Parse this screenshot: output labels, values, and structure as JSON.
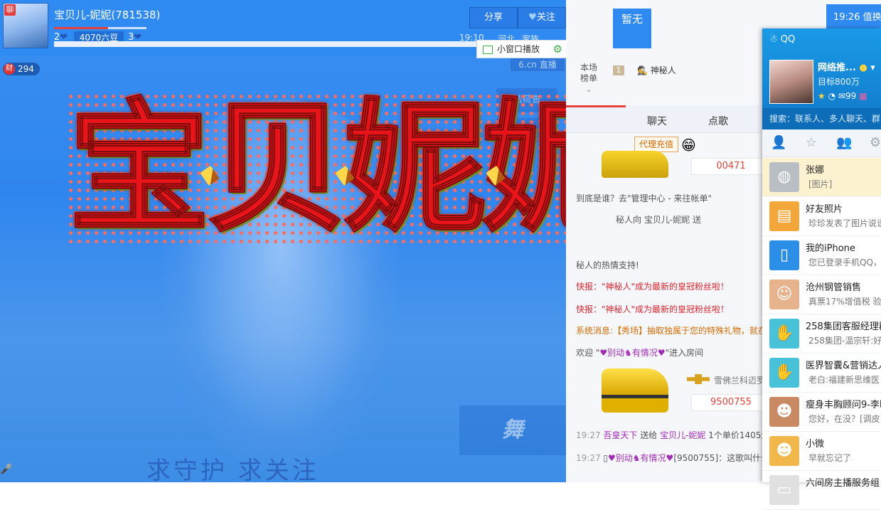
{
  "room": {
    "anchor_name": "宝贝儿-妮妮(781538)",
    "level_left": "2",
    "beans": "4070六豆",
    "level_right": "3",
    "share_label": "分享",
    "follow_label": "关注",
    "time": "19:10",
    "location": "河北",
    "location2": "家族",
    "mini_play": "小窗口播放",
    "wealth_icon": "财",
    "wealth_value": "294",
    "site_tag": "6.cn",
    "site_tag2": "直播",
    "ghost_btn1": "结荷鲁",
    "ghost_btn2": "直",
    "big_text": "宝贝妮妮",
    "slogan": "求守护   求关注",
    "show_logo": "舞",
    "chat_badge": "聊"
  },
  "right": {
    "none_label": "暂无",
    "clock": "19:26",
    "clock_suffix": "值换",
    "rank_label_1": "本场",
    "rank_label_2": "榜单",
    "rank_num": "1",
    "rank_name": "神秘人",
    "tabs": [
      "聊天",
      "点歌"
    ],
    "agent": "代理充值",
    "car_number_1": "00471",
    "msg_who": "到底是谁？去\"管理中心 - 来往帐单\"",
    "msg_send": "秘人向 宝贝儿-妮妮 送",
    "msg_support": "秘人的热情支持!",
    "news1": "快报：\"神秘人\"成为最新的皇冠粉丝啦！",
    "news2": "快报：\"神秘人\"成为最新的皇冠粉丝啦！",
    "system": "系统消息:【秀场】抽取独属于您的特殊礼物，就在",
    "welcome_prefix": "欢迎 \"",
    "welcome_name": "♥别动♞有情况♥",
    "welcome_suffix": "\"进入房间",
    "car_brand": "雪佛兰科迈罗",
    "car_number_2": "9500755",
    "line1_time": "19:27",
    "line1_user": "吾皇天下",
    "line1_mid": " 送给 ",
    "line1_anchor": "宝贝儿-妮妮",
    "line1_tail": " 1个单价1405六",
    "line2_time": "19:27",
    "line2_user": "♥别动♞有情况♥",
    "line2_tail": "[9500755]：这歌叫什么"
  },
  "qq": {
    "title": "QQ",
    "nick": "网络推...",
    "sign": "目标800万",
    "mail_count": "99",
    "search": "搜索：联系人、多人聊天、群",
    "contacts": [
      {
        "name": "张娜",
        "msg": "[图片]",
        "color": "#b9bec4",
        "icon": "◍"
      },
      {
        "name": "好友照片",
        "msg": "珍珍发表了图片说说",
        "color": "#f3a73a",
        "icon": "▤"
      },
      {
        "name": "我的iPhone",
        "msg": "您已登录手机QQ，可",
        "color": "#2b8fe8",
        "icon": "▯"
      },
      {
        "name": "沧州钢管销售",
        "msg": "真票17%增值税 验",
        "color": "#e6b38d",
        "icon": "☺"
      },
      {
        "name": "258集团客服经理群",
        "msg": "258集团-温宗轩:好",
        "color": "#47c2d8",
        "icon": "✋"
      },
      {
        "name": "医界智囊&营销达人",
        "msg": "老白:福建新思维医",
        "color": "#47c2d8",
        "icon": "✋"
      },
      {
        "name": "瘦身丰胸顾问9-李晓",
        "msg": "您好，在没？[调皮]",
        "color": "#c98a63",
        "icon": "☻"
      },
      {
        "name": "小微",
        "msg": "早就忘记了",
        "color": "#f2b74a",
        "icon": "☻"
      },
      {
        "name": "六间房主播服务组",
        "msg": "",
        "color": "#e0e0e0",
        "icon": "▭"
      }
    ]
  }
}
